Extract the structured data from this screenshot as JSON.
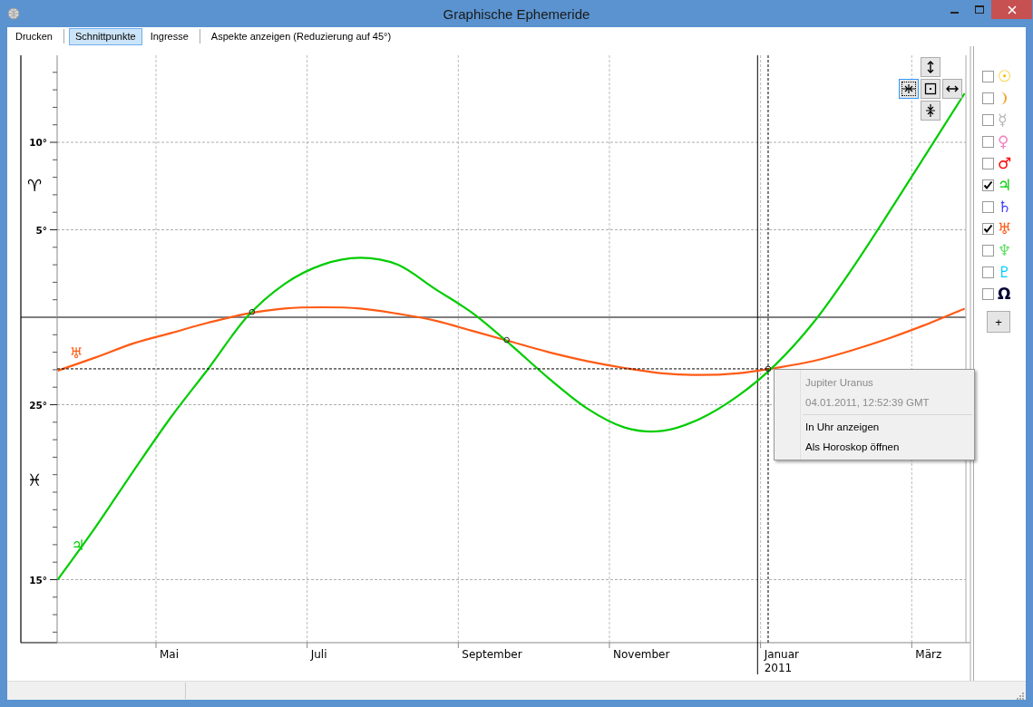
{
  "window": {
    "title": "Graphische Ephemeride"
  },
  "toolbar": [
    {
      "label": "Drucken",
      "selected": false
    },
    {
      "label": "Schnittpunkte",
      "selected": true
    },
    {
      "label": "Ingresse",
      "selected": false
    },
    {
      "label": "Aspekte anzeigen (Reduzierung auf 45°)",
      "selected": false
    }
  ],
  "chart": {
    "y_labels": [
      "10°",
      "5°",
      "25°",
      "15°"
    ],
    "zodiac_signs": [
      "♈",
      "♓"
    ],
    "x_labels": [
      "Mai",
      "Juli",
      "September",
      "November",
      "Januar 2011",
      "März"
    ],
    "planet_labels": [
      {
        "symbol": "♅",
        "color": "#ff5a14"
      },
      {
        "symbol": "♃",
        "color": "#00cc00"
      }
    ]
  },
  "nav_buttons": [
    {
      "kind": "vertical-expand",
      "focused": false
    },
    {
      "kind": "horizontal-shrink",
      "focused": true
    },
    {
      "kind": "center",
      "focused": false
    },
    {
      "kind": "horizontal-expand",
      "focused": false
    },
    {
      "kind": "vertical-shrink",
      "focused": false
    }
  ],
  "sidebar": {
    "items": [
      {
        "symbol": "☉",
        "color": "#f5c400",
        "checked": false
      },
      {
        "kind": "crescent",
        "color": "#f0a020",
        "checked": false
      },
      {
        "symbol": "☿",
        "color": "#b4b4b4",
        "checked": false
      },
      {
        "symbol": "♀",
        "color": "#f080c0",
        "checked": false
      },
      {
        "symbol": "♂",
        "color": "#ff0000",
        "checked": false
      },
      {
        "symbol": "♃",
        "color": "#00cc00",
        "checked": true
      },
      {
        "symbol": "♄",
        "color": "#4040ff",
        "checked": false
      },
      {
        "symbol": "♅",
        "color": "#ff5a14",
        "checked": true
      },
      {
        "symbol": "♆",
        "color": "#60e060",
        "checked": false
      },
      {
        "symbol": "♇",
        "color": "#00ccff",
        "checked": false
      },
      {
        "symbol": "Ω",
        "color": "#000033",
        "checked": false
      }
    ],
    "add_label": "+"
  },
  "context_menu": {
    "title": "Jupiter Uranus",
    "timestamp": "04.01.2011,  12:52:39 GMT",
    "items": [
      "In Uhr anzeigen",
      "Als Horoskop öffnen"
    ]
  }
}
